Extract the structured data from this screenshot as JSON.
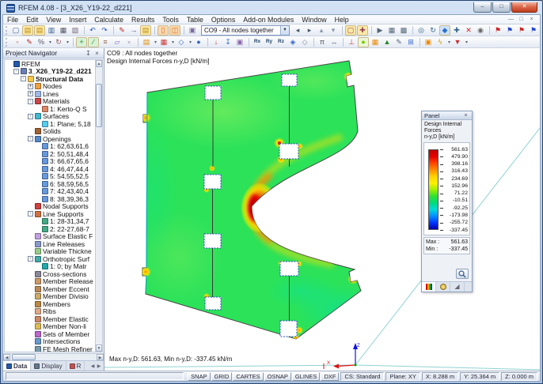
{
  "window": {
    "title": "RFEM 4.08 - [3_X26_Y19-22_d221]"
  },
  "window_controls": {
    "minimize": "–",
    "maximize": "□",
    "close": "✕"
  },
  "mdi_controls": {
    "minimize": "—",
    "restore": "□",
    "close": "×"
  },
  "menu": {
    "items": [
      "File",
      "Edit",
      "View",
      "Insert",
      "Calculate",
      "Results",
      "Tools",
      "Table",
      "Options",
      "Add-on Modules",
      "Window",
      "Help"
    ]
  },
  "toolbar_top": {
    "combo": {
      "value": "CO9 - All nodes together"
    },
    "left_icons": [
      {
        "n": "new-file-button",
        "g": "▢",
        "c": "#3a5a8c"
      },
      {
        "n": "open-project-button",
        "g": "▤",
        "c": "#b8860b",
        "bg": "#fdeaa8"
      },
      {
        "n": "open-model-button",
        "g": "▤",
        "c": "#b8860b",
        "bg": "#fdeaa8"
      },
      {
        "n": "save-button",
        "g": "▥",
        "c": "#33558c"
      },
      {
        "n": "print-button",
        "g": "▦",
        "c": "#556"
      },
      {
        "n": "copy-button",
        "g": "▧",
        "c": "#767"
      },
      {
        "sep": true
      },
      {
        "n": "undo-button",
        "g": "↶",
        "c": "#2255bb"
      },
      {
        "n": "redo-button",
        "g": "↷",
        "c": "#2255bb"
      },
      {
        "sep": true
      },
      {
        "n": "edit-mode-button",
        "g": "✎",
        "c": "#bb2222"
      },
      {
        "n": "export-button",
        "g": "→",
        "c": "#557"
      },
      {
        "n": "project-navigator-button",
        "g": "▤",
        "c": "#b8860b",
        "bg": "#fdeaa8"
      },
      {
        "sep": true
      },
      {
        "n": "show-tables-button",
        "g": "▯",
        "c": "#d2691e",
        "bg": "#fbd9b0"
      },
      {
        "n": "split-window-button",
        "g": "◫",
        "c": "#d2691e",
        "bg": "#fbd9b0"
      },
      {
        "sep": true
      },
      {
        "n": "load-cases-button",
        "g": "▣",
        "c": "#769"
      }
    ],
    "right_icons": [
      {
        "n": "previous-load-case-button",
        "g": "◂",
        "c": "#456"
      },
      {
        "n": "next-load-case-button",
        "g": "▸",
        "c": "#456"
      },
      {
        "n": "first-load-case-button",
        "g": "▴",
        "c": "#89a"
      },
      {
        "n": "last-load-case-button",
        "g": "▾",
        "c": "#89a"
      },
      {
        "sep": true
      },
      {
        "n": "select-window-button",
        "g": "▢",
        "c": "#945",
        "bg": "#fbe9a6"
      },
      {
        "n": "select-special-button",
        "g": "✚",
        "c": "#945",
        "bg": "#fbe9a6"
      },
      {
        "sep": true
      },
      {
        "n": "movie-mode-button",
        "g": "▶",
        "c": "#567"
      },
      {
        "n": "view-manager-button",
        "g": "▦",
        "c": "#567"
      },
      {
        "n": "display-properties-button",
        "g": "▩",
        "c": "#567"
      },
      {
        "sep": true
      },
      {
        "n": "zoom-button",
        "g": "◎",
        "c": "#368"
      },
      {
        "n": "rotate-view-button",
        "g": "↻",
        "c": "#368"
      },
      {
        "n": "rendered-view-button",
        "g": "◆",
        "c": "#2a6fd0",
        "bg": "#cfe2fb"
      },
      {
        "n": "move-view-button",
        "g": "✚",
        "c": "#368"
      },
      {
        "n": "cancel-function-button",
        "g": "✕",
        "c": "#c22"
      },
      {
        "n": "info-button",
        "g": "◉",
        "c": "#666"
      },
      {
        "sep": true
      },
      {
        "n": "show-results-button",
        "g": "⚑",
        "c": "#c22"
      },
      {
        "n": "show-deformation-button",
        "g": "⚑",
        "c": "#24c"
      },
      {
        "n": "result-values-button",
        "g": "⚑",
        "c": "#c22"
      },
      {
        "n": "result-panel-button",
        "g": "⚑",
        "c": "#24c"
      }
    ]
  },
  "toolbar_second": {
    "icons": [
      {
        "n": "snap-button",
        "g": "◦",
        "c": "#c33"
      },
      {
        "n": "edit-layers-button",
        "g": "✎",
        "c": "#b22"
      },
      {
        "n": "percent-button",
        "g": "%",
        "c": "#556",
        "d": true
      },
      {
        "n": "move-copy-button",
        "g": "↻",
        "c": "#856",
        "d": true
      },
      {
        "sep": true
      },
      {
        "n": "new-node-button",
        "g": "+",
        "c": "#282",
        "bg": "#d8f2d8"
      },
      {
        "n": "new-line-button",
        "g": "∕",
        "c": "#282",
        "bg": "#d8f2d8"
      },
      {
        "n": "new-member-button",
        "g": "≡",
        "c": "#964"
      },
      {
        "n": "new-surface-button",
        "g": "▱",
        "c": "#86b"
      },
      {
        "n": "select-rectangle-button",
        "g": "▫",
        "c": "#556"
      },
      {
        "sep": true
      },
      {
        "n": "layers-button",
        "g": "▤",
        "c": "#d80",
        "d": true
      },
      {
        "n": "grid-button",
        "g": "▦",
        "c": "#c33",
        "d": true
      },
      {
        "n": "view-3d-button",
        "g": "◇",
        "c": "#36c",
        "d": true
      },
      {
        "n": "render-button",
        "g": "●",
        "c": "#36c"
      },
      {
        "sep": true
      },
      {
        "n": "loads-button",
        "g": "↓",
        "c": "#c33"
      },
      {
        "n": "load-combinations-button",
        "g": "↧",
        "c": "#36c"
      },
      {
        "n": "generators-button",
        "g": "▣",
        "c": "#86a"
      },
      {
        "sep": true
      },
      {
        "n": "view-x-button",
        "g": "Rx",
        "c": "#246"
      },
      {
        "n": "view-y-button",
        "g": "Ry",
        "c": "#246"
      },
      {
        "n": "view-z-button",
        "g": "Rz",
        "c": "#246"
      },
      {
        "n": "isometric-view-button",
        "g": "◈",
        "c": "#36c"
      },
      {
        "n": "perspective-button",
        "g": "◇",
        "c": "#789"
      },
      {
        "sep": true
      },
      {
        "n": "pi-console-button",
        "g": "π",
        "c": "#556"
      },
      {
        "n": "swap-button",
        "g": "↔",
        "c": "#556"
      },
      {
        "sep": true
      },
      {
        "n": "axes-button",
        "g": "⊥",
        "c": "#c33"
      },
      {
        "n": "result-diagram-button",
        "g": "●",
        "c": "#7c0",
        "bg": "#eaf6d8"
      },
      {
        "n": "mesh-button",
        "g": "▦",
        "c": "#e80"
      },
      {
        "n": "supports-button",
        "g": "▲",
        "c": "#282"
      },
      {
        "n": "dimension-button",
        "g": "✎",
        "c": "#567"
      },
      {
        "n": "fe-grid-button",
        "g": "⊞",
        "c": "#36c"
      },
      {
        "sep": true
      },
      {
        "n": "new-window-button",
        "g": "▣",
        "c": "#e80"
      },
      {
        "n": "lightning-button",
        "g": "ϟ",
        "c": "#c90",
        "d": true
      },
      {
        "n": "color-scale-button",
        "g": "▼",
        "c": "#c33",
        "d": true
      }
    ]
  },
  "navigator": {
    "title": "Project Navigator",
    "tabs": [
      {
        "label": "Data",
        "icon": "rfem",
        "active": true
      },
      {
        "label": "Display",
        "icon": "display",
        "active": false
      },
      {
        "label": "R",
        "icon": "results",
        "active": false
      }
    ],
    "tree": [
      {
        "label": "RFEM",
        "depth": 0,
        "icon": "rfem",
        "exp": ""
      },
      {
        "label": "3_X26_Y19-22_d221",
        "depth": 1,
        "icon": "project",
        "exp": "-",
        "bold": true
      },
      {
        "label": "Structural Data",
        "depth": 2,
        "icon": "folder",
        "exp": "-",
        "bold": true
      },
      {
        "label": "Nodes",
        "depth": 3,
        "icon": "nodes",
        "exp": "+"
      },
      {
        "label": "Lines",
        "depth": 3,
        "icon": "lines",
        "exp": "+"
      },
      {
        "label": "Materials",
        "depth": 3,
        "icon": "materials",
        "exp": "-"
      },
      {
        "label": "1: Kerto-Q S",
        "depth": 4,
        "icon": "material-item",
        "exp": ""
      },
      {
        "label": "Surfaces",
        "depth": 3,
        "icon": "surfaces",
        "exp": "-"
      },
      {
        "label": "1: Plane; 5,18",
        "depth": 4,
        "icon": "surface-item",
        "exp": ""
      },
      {
        "label": "Solids",
        "depth": 3,
        "icon": "solids",
        "exp": ""
      },
      {
        "label": "Openings",
        "depth": 3,
        "icon": "openings",
        "exp": "-"
      },
      {
        "label": "1: 62,63,61,6",
        "depth": 4,
        "icon": "opening-item",
        "exp": ""
      },
      {
        "label": "2: 50,51,48,4",
        "depth": 4,
        "icon": "opening-item",
        "exp": ""
      },
      {
        "label": "3: 66,67,65,6",
        "depth": 4,
        "icon": "opening-item",
        "exp": ""
      },
      {
        "label": "4: 46,47,44,4",
        "depth": 4,
        "icon": "opening-item",
        "exp": ""
      },
      {
        "label": "5: 54,55,52,5",
        "depth": 4,
        "icon": "opening-item",
        "exp": ""
      },
      {
        "label": "6: 58,59,56,5",
        "depth": 4,
        "icon": "opening-item",
        "exp": ""
      },
      {
        "label": "7: 42,43,40,4",
        "depth": 4,
        "icon": "opening-item",
        "exp": ""
      },
      {
        "label": "8: 38,39,36,3",
        "depth": 4,
        "icon": "opening-item",
        "exp": ""
      },
      {
        "label": "Nodal Supports",
        "depth": 3,
        "icon": "nodal-supports",
        "exp": ""
      },
      {
        "label": "Line Supports",
        "depth": 3,
        "icon": "line-supports",
        "exp": "-"
      },
      {
        "label": "1: 28-31,34,7",
        "depth": 4,
        "icon": "line-support-item",
        "exp": ""
      },
      {
        "label": "2: 22-27,68-7",
        "depth": 4,
        "icon": "line-support-item",
        "exp": ""
      },
      {
        "label": "Surface Elastic F",
        "depth": 3,
        "icon": "surface-elastic",
        "exp": ""
      },
      {
        "label": "Line Releases",
        "depth": 3,
        "icon": "line-releases",
        "exp": ""
      },
      {
        "label": "Variable Thickne",
        "depth": 3,
        "icon": "variable-thickness",
        "exp": ""
      },
      {
        "label": "Orthotropic Surf",
        "depth": 3,
        "icon": "orthotropic",
        "exp": "-"
      },
      {
        "label": "1: 0; by Matr",
        "depth": 4,
        "icon": "ortho-item",
        "exp": ""
      },
      {
        "label": "Cross-sections",
        "depth": 3,
        "icon": "cross-sections",
        "exp": ""
      },
      {
        "label": "Member Release",
        "depth": 3,
        "icon": "member-releases",
        "exp": ""
      },
      {
        "label": "Member Eccent",
        "depth": 3,
        "icon": "member-eccentricities",
        "exp": ""
      },
      {
        "label": "Member Divisio",
        "depth": 3,
        "icon": "member-divisions",
        "exp": ""
      },
      {
        "label": "Members",
        "depth": 3,
        "icon": "members",
        "exp": ""
      },
      {
        "label": "Ribs",
        "depth": 3,
        "icon": "ribs",
        "exp": ""
      },
      {
        "label": "Member Elastic",
        "depth": 3,
        "icon": "member-elastic",
        "exp": ""
      },
      {
        "label": "Member Non-li",
        "depth": 3,
        "icon": "member-nonlinearities",
        "exp": ""
      },
      {
        "label": "Sets of Member",
        "depth": 3,
        "icon": "sets-of-members",
        "exp": ""
      },
      {
        "label": "Intersections",
        "depth": 3,
        "icon": "intersections",
        "exp": ""
      },
      {
        "label": "FE Mesh Refiner",
        "depth": 3,
        "icon": "fe-mesh",
        "exp": ""
      }
    ]
  },
  "viewport": {
    "caption_line1": "CO9 : All nodes together",
    "caption_line2": "Design Internal Forces n-y,D [kN/m]",
    "status_message": "Max n-y,D: 561.63, Min n-y,D: -337.45 kN/m",
    "axis_x_label": "X",
    "axis_z_label": "Z"
  },
  "panel": {
    "title": "Panel",
    "close_glyph": "×",
    "header_line1": "Design Internal Forces",
    "header_line2": "n-y,D [kN/m]",
    "legend_values": [
      "561.63",
      "479.90",
      "398.16",
      "316.43",
      "234.69",
      "152.96",
      "71.22",
      "-10.51",
      "-92.25",
      "-173.98",
      "-255.72",
      "-337.45"
    ],
    "legend_gradient": [
      "#c00000",
      "#e60000",
      "#ff4600",
      "#ff8c00",
      "#ffd200",
      "#fff000",
      "#a0f000",
      "#30e030",
      "#00dc78",
      "#00d8d8",
      "#0090ff",
      "#0038ff",
      "#0000b0"
    ],
    "max_label": "Max :",
    "max_value": "561.63",
    "min_label": "Min :",
    "min_value": "-337.45"
  },
  "statusbar": {
    "buttons": [
      "SNAP",
      "GRID",
      "CARTES",
      "OSNAP",
      "GLINES",
      "DXF"
    ],
    "fields": [
      "CS: Standard",
      "Plane: XY",
      "X: 8.288 m",
      "Y: 25.364 m",
      "Z: 0.000 m"
    ]
  },
  "colors": {
    "plate_green": "#2be259",
    "hot_red": "#d40000",
    "guide_cyan": "#8fd2d2",
    "opening_border_blue": "#2a52b4",
    "support_teal": "#00c0c0",
    "tree_icons": {
      "rfem": "#2458a8",
      "project": "#6a7fb8",
      "folder": "#f6c84a",
      "nodes": "#f0a040",
      "lines": "#9db7e8",
      "materials": "#cc4444",
      "material-item": "#dd8866",
      "surfaces": "#40b8d0",
      "surface-item": "#55ccee",
      "solids": "#a06030",
      "openings": "#5588cc",
      "opening-item": "#6699dd",
      "nodal-supports": "#d04040",
      "line-supports": "#d07040",
      "line-support-item": "#44aa88",
      "surface-elastic": "#c0a0e0",
      "line-releases": "#8899cc",
      "variable-thickness": "#99cc88",
      "orthotropic": "#44aaaa",
      "ortho-item": "#22aaaa",
      "cross-sections": "#888899",
      "member-releases": "#cc9966",
      "member-eccentricities": "#bb8855",
      "member-divisions": "#ccaa66",
      "members": "#bb8844",
      "ribs": "#ddaa88",
      "member-elastic": "#cc8866",
      "member-nonlinearities": "#ddbb55",
      "sets-of-members": "#bb66cc",
      "intersections": "#6699cc",
      "fe-mesh": "#7799aa",
      "display": "#667788",
      "results": "#bb5555"
    }
  }
}
